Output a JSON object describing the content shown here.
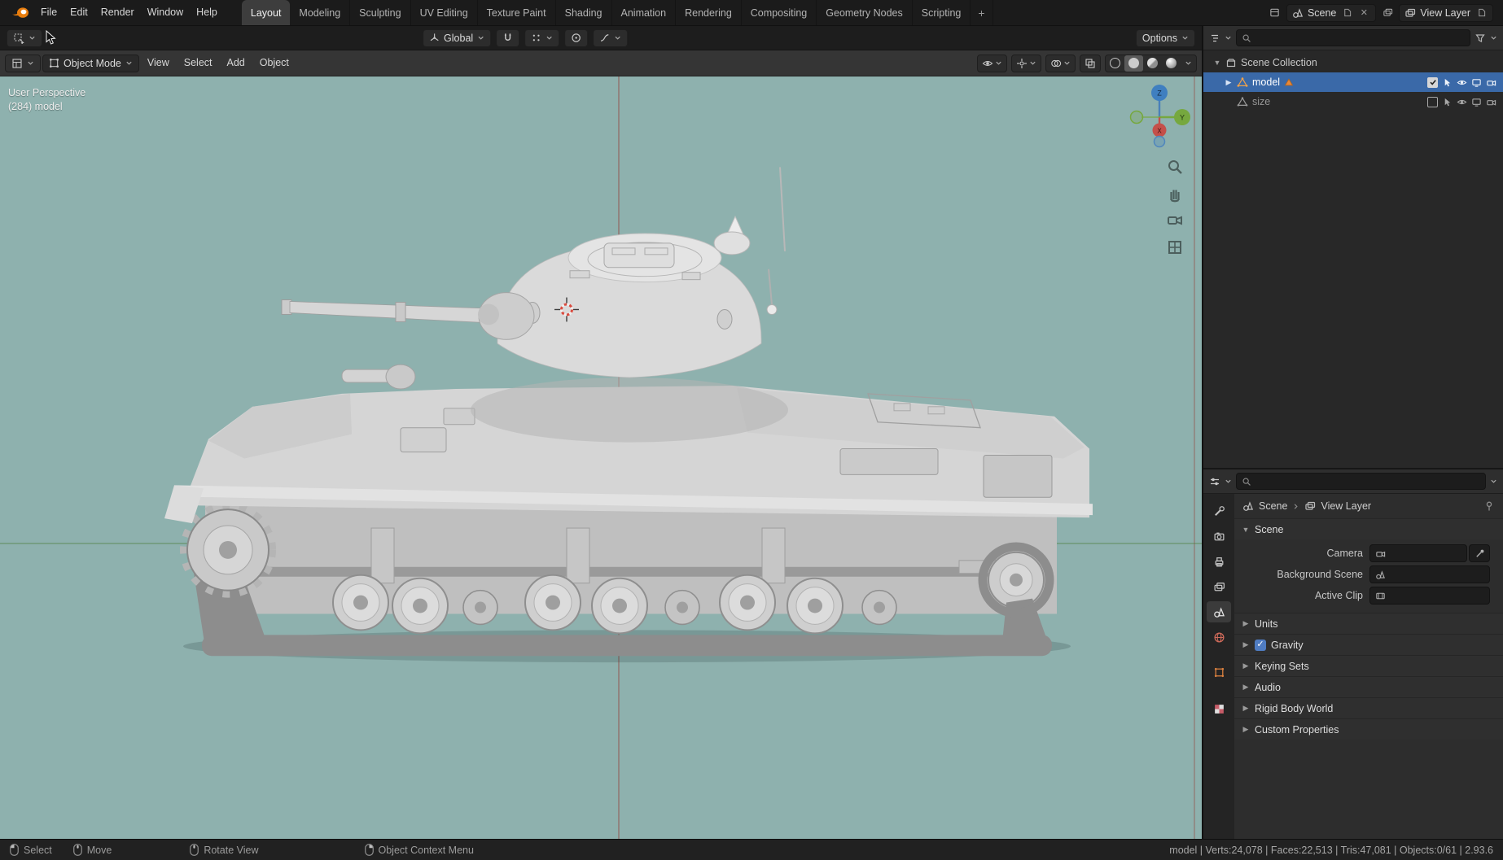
{
  "colors": {
    "viewport_bg": "#8eb1ae",
    "selection_blue": "#3a69a8",
    "blender_orange": "#e87d0d",
    "axis_x_red": "#c4504a",
    "axis_y_green": "#76a83f",
    "axis_z_blue": "#3f7fc0",
    "checkbox_blue": "#4f7cc2"
  },
  "icons": {
    "disclosure_open": "▼",
    "disclosure_closed": "▶",
    "close": "✕",
    "check": "✓"
  },
  "topbar": {
    "menus": [
      "File",
      "Edit",
      "Render",
      "Window",
      "Help"
    ],
    "workspaces": [
      "Layout",
      "Modeling",
      "Sculpting",
      "UV Editing",
      "Texture Paint",
      "Shading",
      "Animation",
      "Rendering",
      "Compositing",
      "Geometry Nodes",
      "Scripting"
    ],
    "active_workspace": "Layout",
    "add_workspace": "+",
    "scene_label": "Scene",
    "view_layer_label": "View Layer"
  },
  "viewport": {
    "toolbar": {
      "orientation": "Global",
      "options": "Options"
    },
    "header": {
      "mode": "Object Mode",
      "menus": [
        "View",
        "Select",
        "Add",
        "Object"
      ]
    },
    "overlay": {
      "perspective": "User Perspective",
      "collection": "(284) model"
    }
  },
  "gizmo": {
    "x": "X",
    "y": "Y",
    "z": "Z"
  },
  "outliner": {
    "rows": [
      {
        "label": "Scene Collection"
      },
      {
        "label": "model",
        "selected": true
      },
      {
        "label": "size"
      }
    ]
  },
  "properties": {
    "breadcrumb": {
      "scene": "Scene",
      "view_layer": "View Layer"
    },
    "scene_panel": {
      "title": "Scene",
      "fields": [
        {
          "label": "Camera"
        },
        {
          "label": "Background Scene"
        },
        {
          "label": "Active Clip"
        }
      ]
    },
    "panels": [
      "Units",
      "Gravity",
      "Keying Sets",
      "Audio",
      "Rigid Body World",
      "Custom Properties"
    ]
  },
  "statusbar": {
    "hints": [
      "Select",
      "Move",
      "Rotate View",
      "Object Context Menu"
    ],
    "stats": "model | Verts:24,078 | Faces:22,513 | Tris:47,081 | Objects:0/61 | 2.93.6"
  }
}
